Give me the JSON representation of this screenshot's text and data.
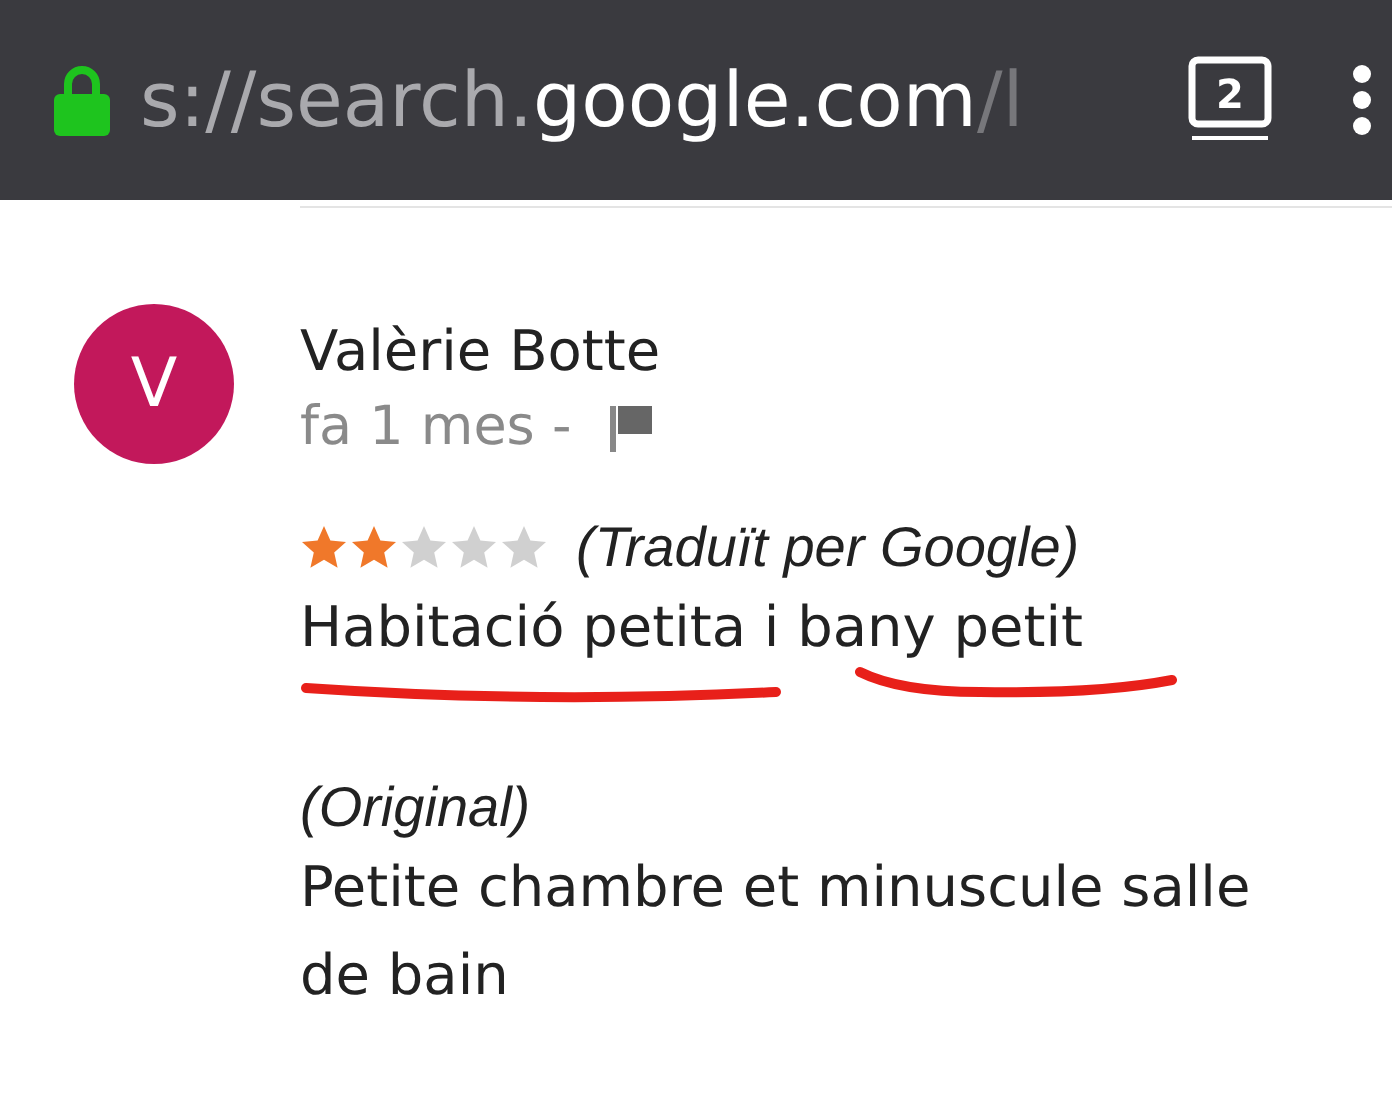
{
  "toolbar": {
    "url_scheme": "s://search.",
    "url_domain": "google.com",
    "url_path": "/l",
    "tab_count": "2"
  },
  "review": {
    "avatar_letter": "V",
    "author": "Valèrie Botte",
    "time": "fa 1 mes -",
    "stars": 2,
    "translated_label": "(Traduït per Google)",
    "translated_text": "Habitació petita i bany petit",
    "original_label": "(Original)",
    "original_text": "Petite chambre et minuscule salle de bain"
  }
}
